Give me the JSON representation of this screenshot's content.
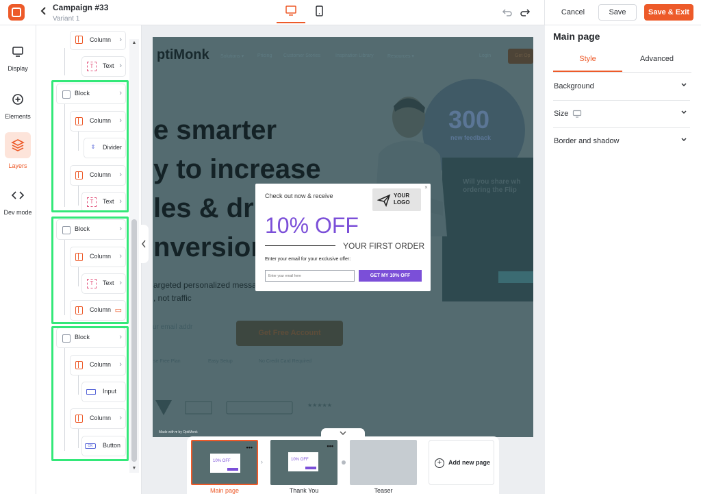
{
  "header": {
    "campaign_title": "Campaign #33",
    "variant_name": "Variant 1",
    "cancel_label": "Cancel",
    "save_label": "Save",
    "save_exit_label": "Save & Exit",
    "active_device": "desktop"
  },
  "leftnav": {
    "items": [
      {
        "label": "Display",
        "icon": "monitor-icon"
      },
      {
        "label": "Elements",
        "icon": "plus-circle-icon"
      },
      {
        "label": "Layers",
        "icon": "layers-icon",
        "active": true
      },
      {
        "label": "Dev mode",
        "icon": "code-icon"
      }
    ]
  },
  "layers": {
    "rows": [
      {
        "label": "Column",
        "type": "column"
      },
      {
        "label": "Text",
        "type": "text"
      },
      {
        "label": "Block",
        "type": "block"
      },
      {
        "label": "Column",
        "type": "column"
      },
      {
        "label": "Divider",
        "type": "divider"
      },
      {
        "label": "Column",
        "type": "column"
      },
      {
        "label": "Text",
        "type": "text"
      },
      {
        "label": "Block",
        "type": "block"
      },
      {
        "label": "Column",
        "type": "column"
      },
      {
        "label": "Text",
        "type": "text"
      },
      {
        "label": "Column",
        "type": "column"
      },
      {
        "label": "Block",
        "type": "block"
      },
      {
        "label": "Column",
        "type": "column"
      },
      {
        "label": "Input",
        "type": "input"
      },
      {
        "label": "Column",
        "type": "column"
      },
      {
        "label": "Button",
        "type": "button"
      }
    ]
  },
  "site": {
    "brand": "ptiMonk",
    "nav": [
      "Solutions ▾",
      "Pricing",
      "Customer Stories",
      "Inspiration Library",
      "Resources ▾",
      "Login",
      "Get Op"
    ],
    "hero_lines": [
      "e smarter",
      "y to increase",
      "les & dri",
      "nversion"
    ],
    "subhero": [
      "argeted personalized messag",
      ", not traffic"
    ],
    "cta": "Get Free Account",
    "email_field": "ur email addr",
    "feature_links": [
      "se Free Plan",
      "Easy Setup",
      "No Credit Card Required"
    ],
    "big_number": "300",
    "big_number_caption": "new feedback",
    "card_heading": "Will you share wh ordering the Flip",
    "made_with": "Made with ♥ by OptiMonk"
  },
  "popup": {
    "headline": "Check out now & receive",
    "logo_line1": "YOUR",
    "logo_line2": "LOGO",
    "offer": "10% OFF",
    "sub": "YOUR FIRST ORDER",
    "email_label": "Enter your email for your exclusive offer:",
    "email_placeholder": "Enter your email here",
    "button_label": "GET MY 10% OFF",
    "close_glyph": "×"
  },
  "pages": {
    "items": [
      {
        "label": "Main page",
        "active": true
      },
      {
        "label": "Thank You",
        "active": false
      },
      {
        "label": "Teaser",
        "active": false
      }
    ],
    "add_label": "Add new page"
  },
  "rightpanel": {
    "title": "Main page",
    "tabs": [
      {
        "label": "Style",
        "active": true
      },
      {
        "label": "Advanced",
        "active": false
      }
    ],
    "sections": [
      "Background",
      "Size",
      "Border and shadow"
    ]
  },
  "colors": {
    "accent": "#ed5a29",
    "popup_purple": "#7b4fd8",
    "highlight_green": "#33e879"
  }
}
